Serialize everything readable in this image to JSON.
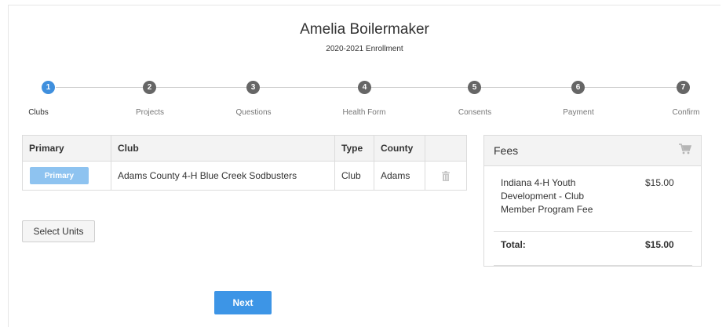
{
  "header": {
    "name": "Amelia Boilermaker",
    "subtitle": "2020-2021 Enrollment"
  },
  "steps": [
    {
      "number": "1",
      "label": "Clubs",
      "active": true
    },
    {
      "number": "2",
      "label": "Projects",
      "active": false
    },
    {
      "number": "3",
      "label": "Questions",
      "active": false
    },
    {
      "number": "4",
      "label": "Health Form",
      "active": false
    },
    {
      "number": "5",
      "label": "Consents",
      "active": false
    },
    {
      "number": "6",
      "label": "Payment",
      "active": false
    },
    {
      "number": "7",
      "label": "Confirm",
      "active": false
    }
  ],
  "clubs_table": {
    "headers": [
      "Primary",
      "Club",
      "Type",
      "County"
    ],
    "rows": [
      {
        "primary_label": "Primary",
        "club": "Adams County 4-H Blue Creek Sodbusters",
        "type": "Club",
        "county": "Adams",
        "delete_icon": "trash-icon"
      }
    ]
  },
  "select_units_label": "Select Units",
  "next_label": "Next",
  "fees": {
    "title": "Fees",
    "cart_icon": "cart-icon",
    "items": [
      {
        "name": "Indiana 4-H Youth Development - Club Member Program Fee",
        "amount": "$15.00"
      }
    ],
    "total_label": "Total:",
    "total_amount": "$15.00"
  },
  "colors": {
    "active_step": "#3f8fdd",
    "inactive_step": "#666666",
    "primary_button": "#8ec3f0",
    "next_button": "#3d95e6"
  }
}
